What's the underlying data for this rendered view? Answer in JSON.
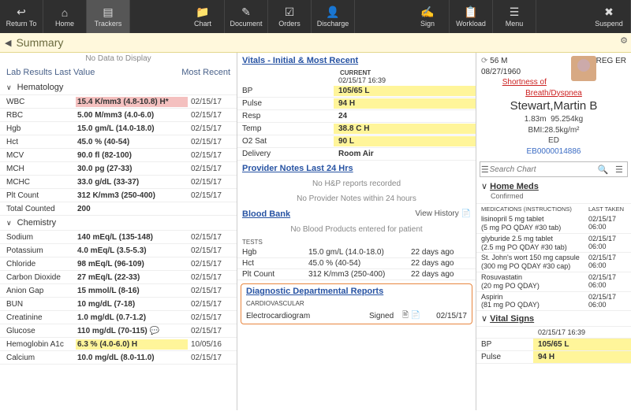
{
  "toolbar": {
    "items": [
      "Return To",
      "Home",
      "Trackers",
      "",
      "Chart",
      "Document",
      "Orders",
      "Discharge",
      "",
      "Sign",
      "Workload",
      "Menu",
      "",
      "Suspend"
    ],
    "active": 2
  },
  "summary": {
    "label": "Summary",
    "noData": "No Data to Display"
  },
  "labs": {
    "title": "Lab Results Last Value",
    "right": "Most Recent",
    "groups": [
      {
        "name": "Hematology",
        "rows": [
          {
            "n": "WBC",
            "v": "15.4 K/mm3 (4.8-10.8) H*",
            "d": "02/15/17",
            "hl": "red"
          },
          {
            "n": "RBC",
            "v": "5.00 M/mm3 (4.0-6.0)",
            "d": "02/15/17"
          },
          {
            "n": "Hgb",
            "v": "15.0 gm/L (14.0-18.0)",
            "d": "02/15/17"
          },
          {
            "n": "Hct",
            "v": "45.0 % (40-54)",
            "d": "02/15/17"
          },
          {
            "n": "MCV",
            "v": "90.0 fl (82-100)",
            "d": "02/15/17"
          },
          {
            "n": "MCH",
            "v": "30.0 pg (27-33)",
            "d": "02/15/17"
          },
          {
            "n": "MCHC",
            "v": "33.0 g/dL (33-37)",
            "d": "02/15/17"
          },
          {
            "n": "Plt Count",
            "v": "312 K/mm3 (250-400)",
            "d": "02/15/17"
          },
          {
            "n": "Total Counted",
            "v": "200",
            "d": ""
          }
        ]
      },
      {
        "name": "Chemistry",
        "rows": [
          {
            "n": "Sodium",
            "v": "140 mEq/L (135-148)",
            "d": "02/15/17"
          },
          {
            "n": "Potassium",
            "v": "4.0 mEq/L (3.5-5.3)",
            "d": "02/15/17"
          },
          {
            "n": "Chloride",
            "v": "98 mEq/L (96-109)",
            "d": "02/15/17"
          },
          {
            "n": "Carbon Dioxide",
            "v": "27 mEq/L (22-33)",
            "d": "02/15/17"
          },
          {
            "n": "Anion Gap",
            "v": "15 mmol/L (8-16)",
            "d": "02/15/17"
          },
          {
            "n": "BUN",
            "v": "10 mg/dL (7-18)",
            "d": "02/15/17"
          },
          {
            "n": "Creatinine",
            "v": "1.0 mg/dL (0.7-1.2)",
            "d": "02/15/17"
          },
          {
            "n": "Glucose",
            "v": "110 mg/dL (70-115)",
            "d": "02/15/17",
            "icon": true
          },
          {
            "n": "Hemoglobin A1c",
            "v": "6.3 % (4.0-6.0) H",
            "d": "10/05/16",
            "hl": "yel"
          },
          {
            "n": "Calcium",
            "v": "10.0 mg/dL (8.0-11.0)",
            "d": "02/15/17"
          }
        ]
      }
    ]
  },
  "vitals": {
    "title": "Vitals - Initial & Most Recent",
    "colLabel": "CURRENT",
    "colTime": "02/15/17 16:39",
    "rows": [
      {
        "n": "BP",
        "v": "105/65 L",
        "hl": "yel"
      },
      {
        "n": "Pulse",
        "v": "94 H",
        "hl": "yel"
      },
      {
        "n": "Resp",
        "v": "24"
      },
      {
        "n": "Temp",
        "v": "38.8 C H",
        "hl": "yel"
      },
      {
        "n": "O2 Sat",
        "v": "90 L",
        "hl": "yel"
      },
      {
        "n": "Delivery",
        "v": "Room Air"
      }
    ]
  },
  "provNotes": {
    "title": "Provider Notes Last 24 Hrs",
    "l1": "No H&P reports recorded",
    "l2": "No Provider Notes within 24 hours"
  },
  "blood": {
    "title": "Blood Bank",
    "right": "View History",
    "msg": "No Blood Products entered for patient",
    "testsLabel": "TESTS",
    "rows": [
      {
        "n": "Hgb",
        "v": "15.0 gm/L (14.0-18.0)",
        "d": "22 days ago"
      },
      {
        "n": "Hct",
        "v": "45.0 % (40-54)",
        "d": "22 days ago"
      },
      {
        "n": "Plt Count",
        "v": "312 K/mm3 (250-400)",
        "d": "22 days ago"
      }
    ]
  },
  "diag": {
    "title": "Diagnostic Departmental Reports",
    "sub": "CARDIOVASCULAR",
    "row": {
      "name": "Electrocardiogram",
      "status": "Signed",
      "date": "02/15/17"
    }
  },
  "patient": {
    "age": "56  M",
    "dob": "08/27/1960",
    "loc": "REG ER",
    "complaint": "Shortness of Breath/Dyspnea",
    "name": "Stewart,Martin B",
    "ht": "1.83m",
    "wt": "95.254kg",
    "bmi": "BMI:28.5kg/m²",
    "dept": "ED",
    "mrn": "EB0000014886"
  },
  "search": {
    "placeholder": "Search Chart"
  },
  "homeMeds": {
    "title": "Home Meds",
    "sub": "Confirmed",
    "hdr1": "MEDICATIONS (INSTRUCTIONS)",
    "hdr2": "LAST TAKEN",
    "rows": [
      {
        "a": "lisinopril 5 mg tablet\n(5 mg PO QDAY #30 tab)",
        "b": "02/15/17 06:00"
      },
      {
        "a": "glyburide 2.5 mg tablet\n(2.5 mg PO QDAY #30 tab)",
        "b": "02/15/17 06:00"
      },
      {
        "a": "St. John's wort 150 mg capsule\n(300 mg PO QDAY #30 cap)",
        "b": "02/15/17 06:00"
      },
      {
        "a": "Rosuvastatin\n(20 mg PO QDAY)",
        "b": "02/15/17 06:00"
      },
      {
        "a": "Aspirin\n(81 mg PO QDAY)",
        "b": "02/15/17 06:00"
      }
    ]
  },
  "vitalSigns": {
    "title": "Vital Signs",
    "time": "02/15/17 16:39",
    "rows": [
      {
        "n": "BP",
        "v": "105/65 L",
        "hl": "yel"
      },
      {
        "n": "Pulse",
        "v": "94 H",
        "hl": "yel"
      }
    ]
  }
}
